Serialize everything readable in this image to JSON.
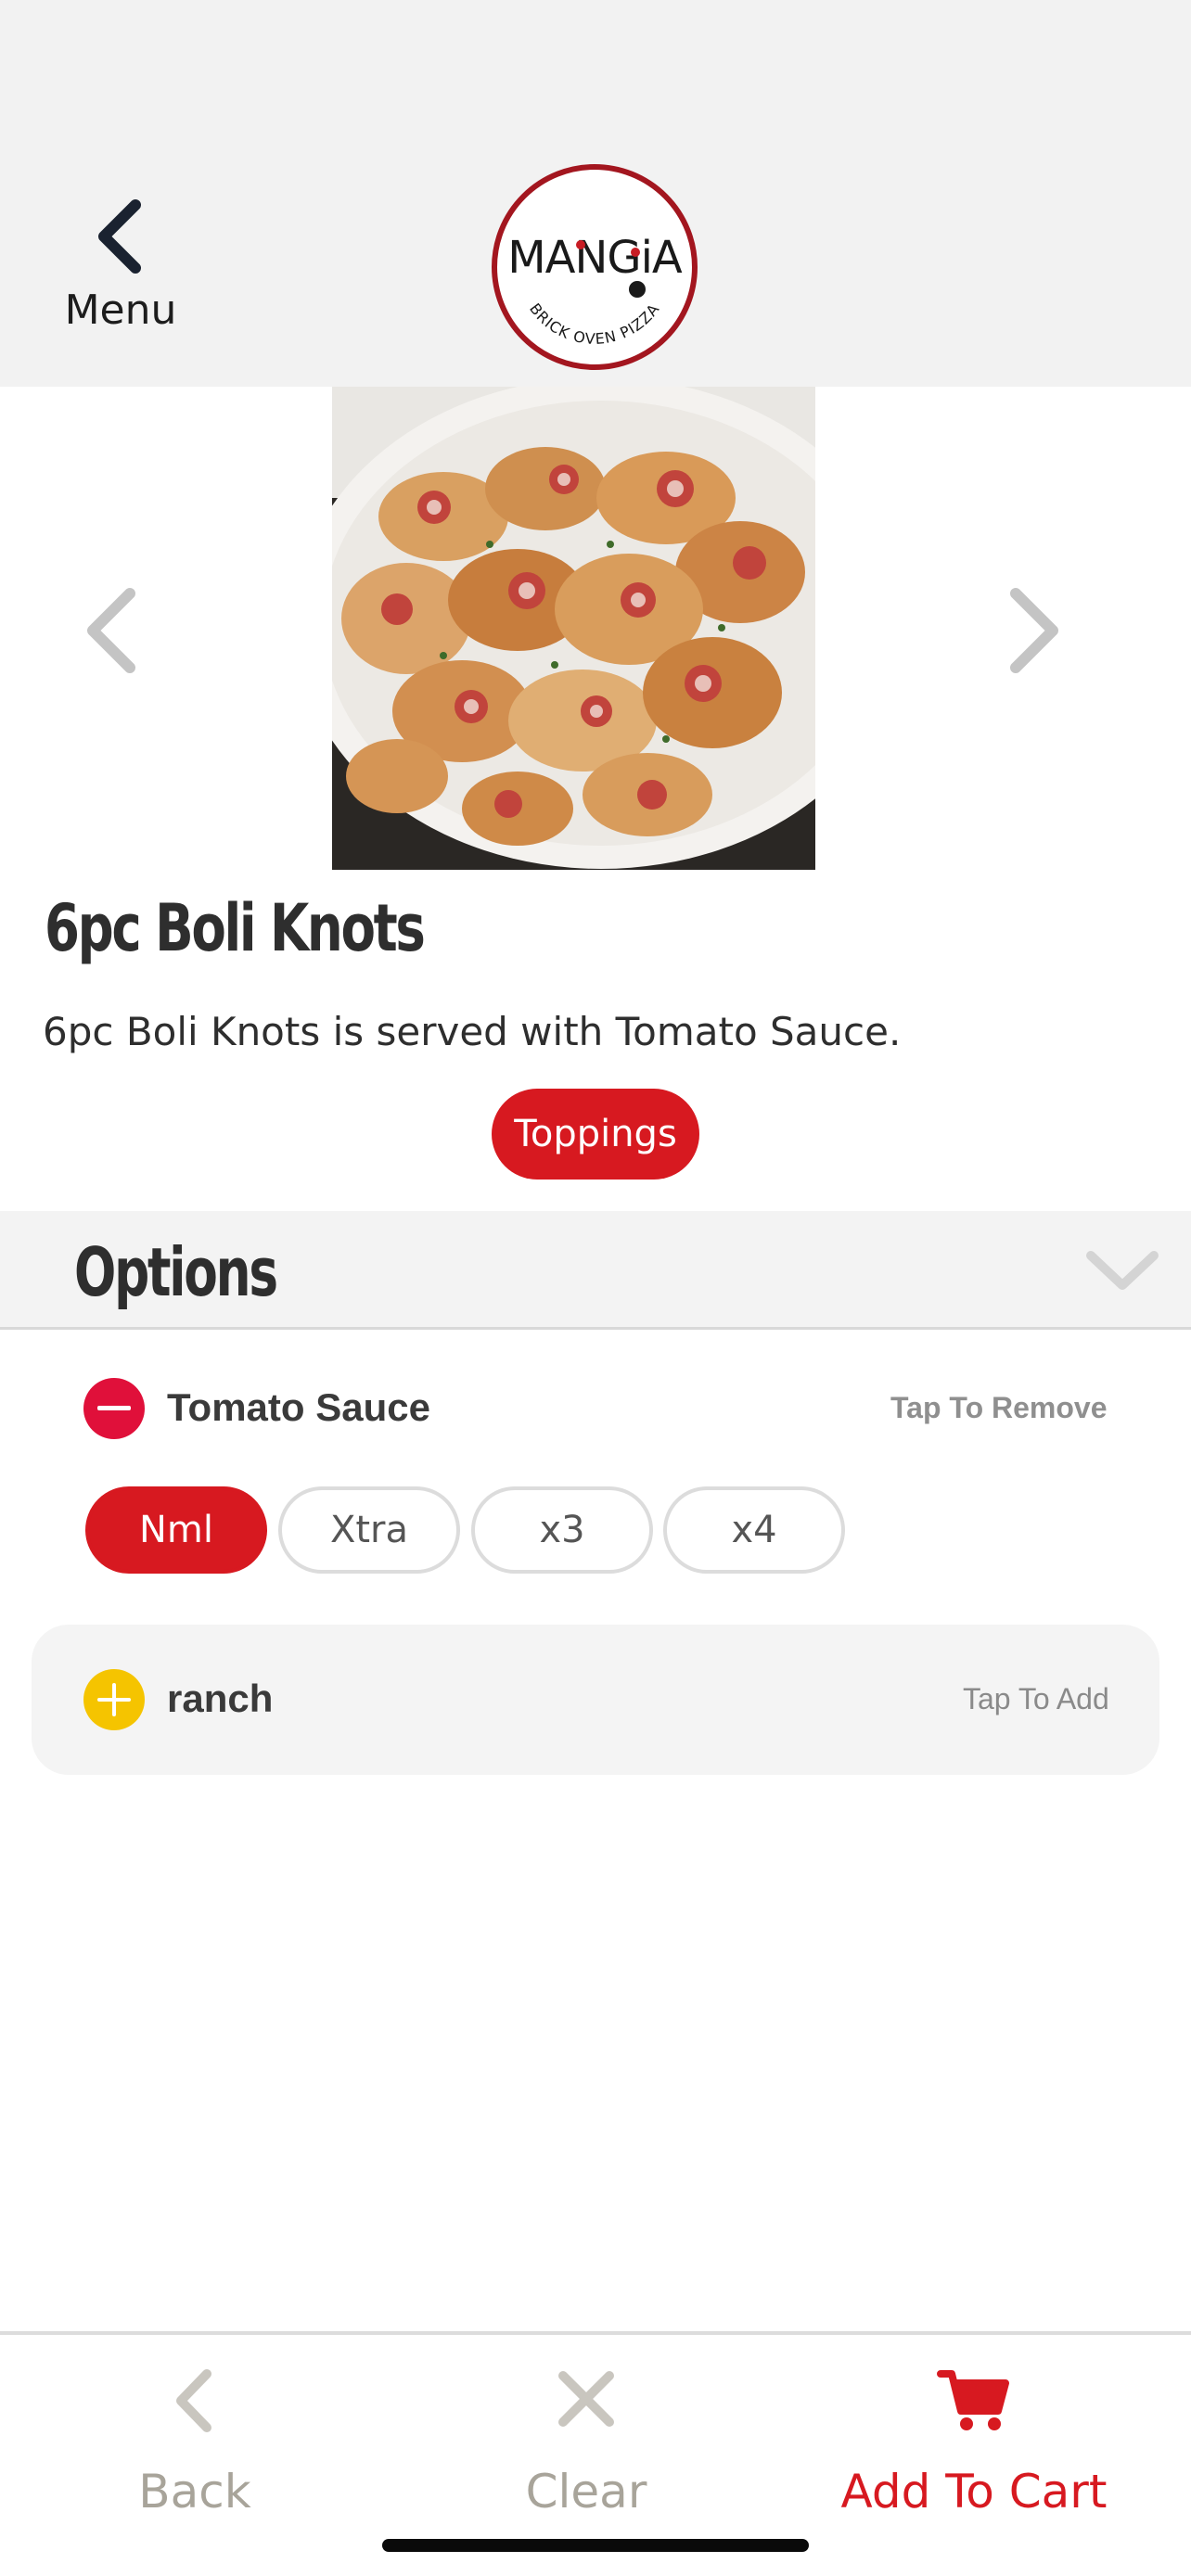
{
  "header": {
    "back_label": "Menu",
    "logo_text": "MANGiA",
    "logo_subtext": "BRICK OVEN PIZZA"
  },
  "product": {
    "title": "6pc Boli Knots",
    "description": "6pc Boli Knots is served with Tomato Sauce.",
    "toppings_button": "Toppings"
  },
  "options": {
    "title": "Options",
    "items": [
      {
        "name": "Tomato Sauce",
        "action": "Tap To Remove",
        "state": "selected",
        "quantities": [
          "Nml",
          "Xtra",
          "x3",
          "x4"
        ],
        "selected_quantity": "Nml"
      },
      {
        "name": "ranch",
        "action": "Tap To Add",
        "state": "unselected"
      }
    ]
  },
  "tabbar": {
    "back": "Back",
    "clear": "Clear",
    "add_to_cart": "Add To Cart"
  },
  "colors": {
    "accent_red": "#d71920",
    "remove_icon": "#e0103a",
    "add_icon": "#f5c400",
    "inactive_tab": "#a8a49a",
    "header_bg": "#f2f2f2"
  },
  "icons": {
    "back": "chevron-left-icon",
    "carousel_prev": "chevron-left-icon",
    "carousel_next": "chevron-right-icon",
    "options_toggle": "chevron-down-icon",
    "remove": "minus-circle-icon",
    "add": "plus-circle-icon",
    "tab_back": "chevron-left-icon",
    "tab_clear": "x-icon",
    "tab_cart": "cart-icon"
  }
}
